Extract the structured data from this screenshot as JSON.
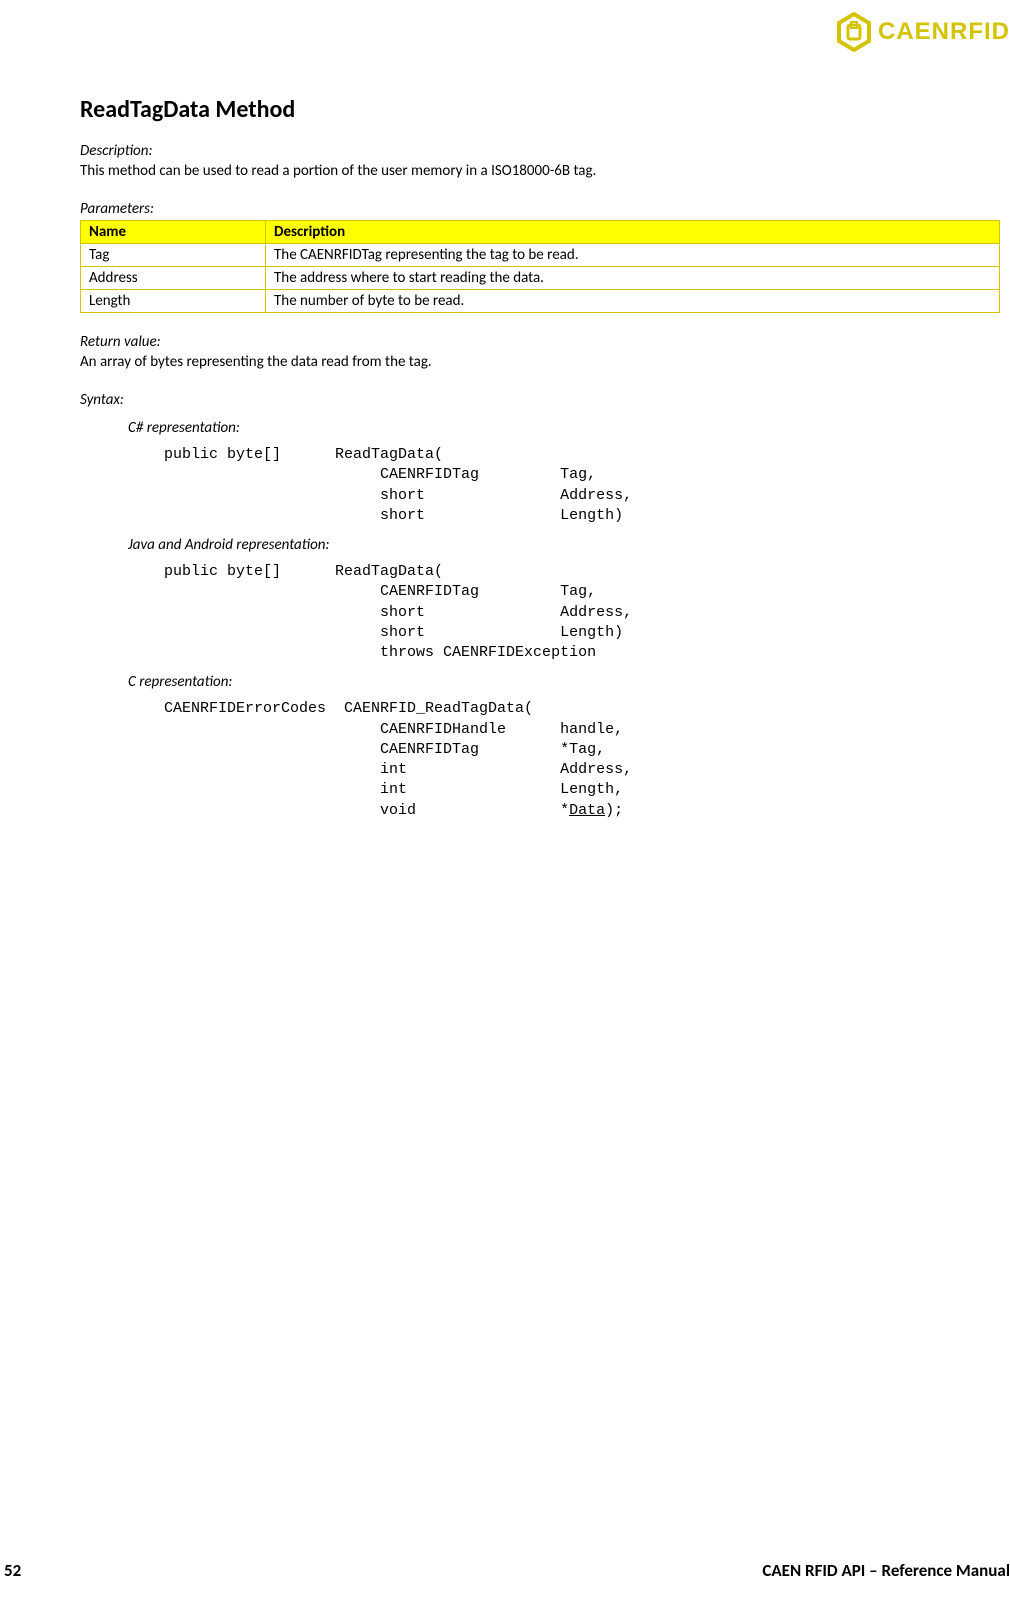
{
  "logo": {
    "brand": "CAENRFID"
  },
  "title": "ReadTagData Method",
  "description": {
    "label": "Description:",
    "text": "This method can be used to read a portion of the user memory in a ISO18000-6B tag."
  },
  "parameters": {
    "label": "Parameters:",
    "header": {
      "name": "Name",
      "desc": "Description"
    },
    "rows": [
      {
        "name": "Tag",
        "desc": "The CAENRFIDTag representing the tag to be read."
      },
      {
        "name": "Address",
        "desc": "The address where to start reading the data."
      },
      {
        "name": "Length",
        "desc": "The number of byte to be read."
      }
    ]
  },
  "return": {
    "label": "Return value:",
    "text": "An array of bytes representing the data read from the tag."
  },
  "syntax": {
    "label": "Syntax:",
    "csharp": {
      "label": "C# representation:",
      "code": "public byte[]      ReadTagData(\n                        CAENRFIDTag         Tag,\n                        short               Address,\n                        short               Length)"
    },
    "java": {
      "label": "Java and Android representation:",
      "code": "public byte[]      ReadTagData(\n                        CAENRFIDTag         Tag,\n                        short               Address,\n                        short               Length)\n                        throws CAENRFIDException"
    },
    "c": {
      "label": "C representation:",
      "prefix": "CAENRFIDErrorCodes  CAENRFID_ReadTagData(\n                        CAENRFIDHandle      handle,\n                        CAENRFIDTag         *Tag,\n                        int                 Address,\n                        int                 Length,\n                        void                *",
      "underlined": "Data",
      "suffix": ");"
    }
  },
  "footer": {
    "page": "52",
    "title": "CAEN RFID API – Reference Manual"
  }
}
